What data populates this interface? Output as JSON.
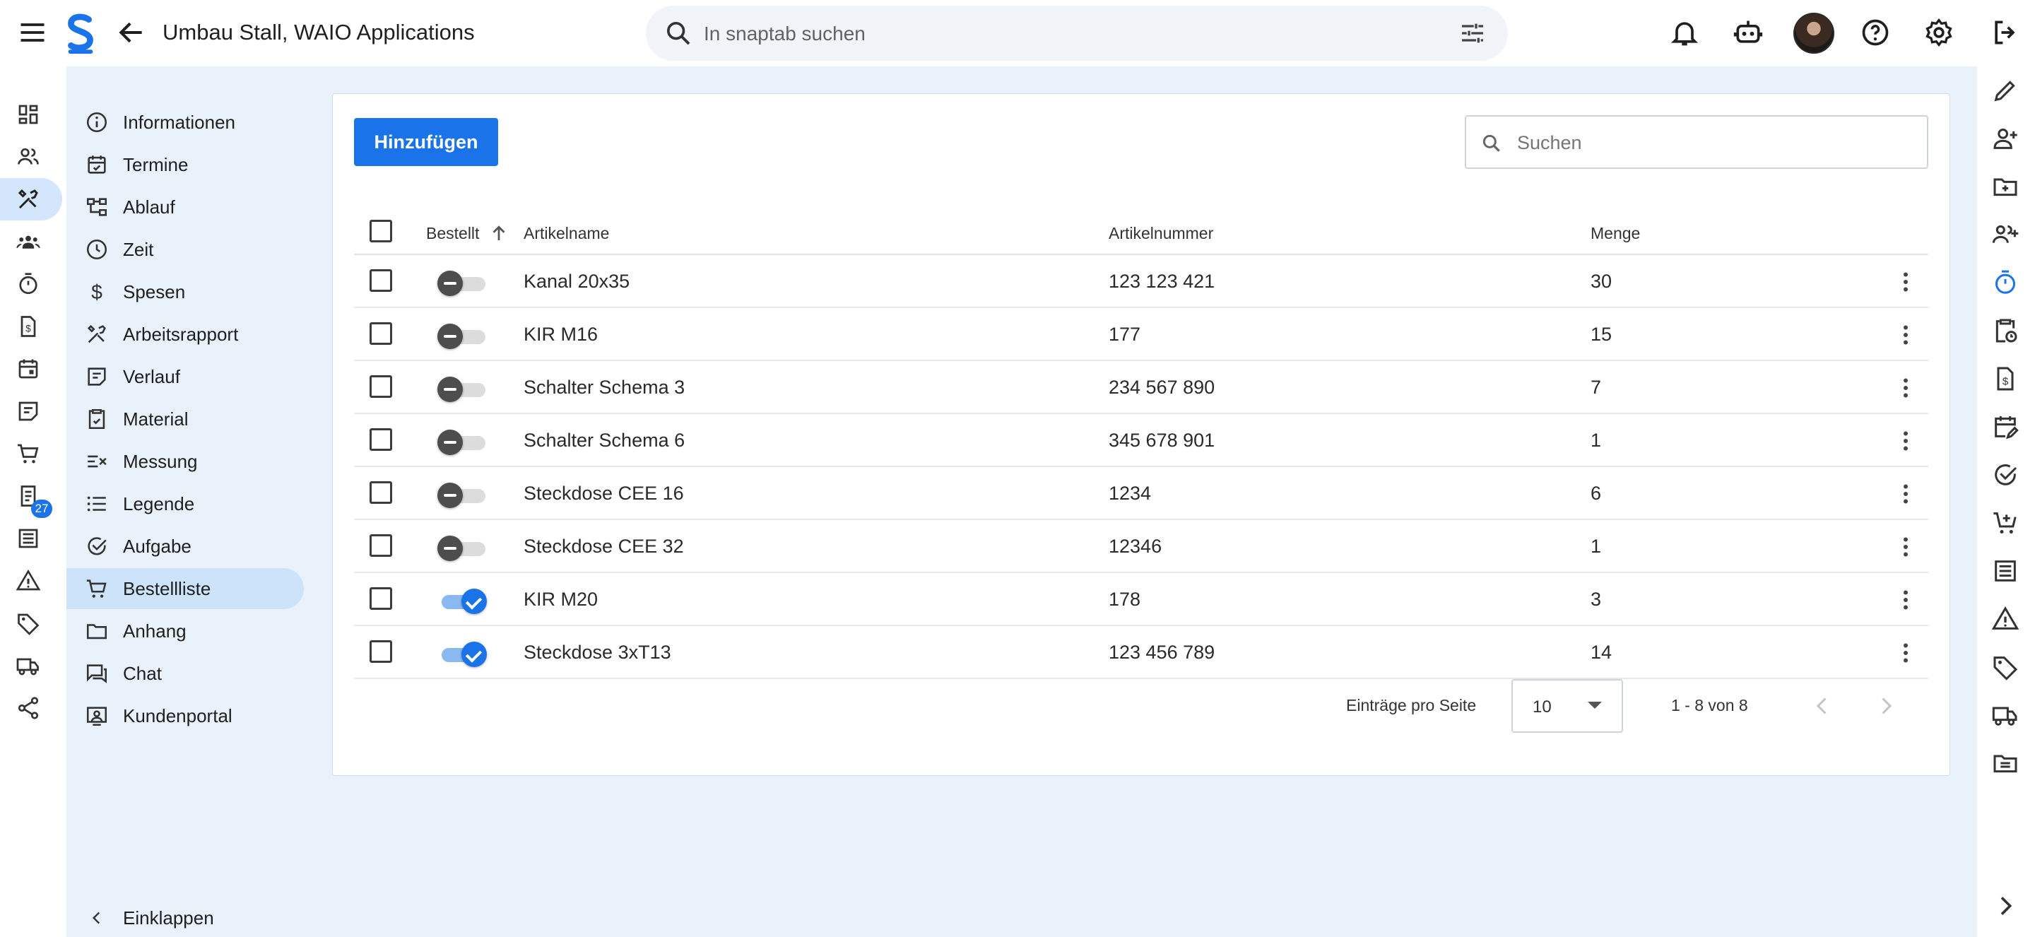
{
  "header": {
    "title": "Umbau Stall, WAIO Applications",
    "search_placeholder": "In snaptab suchen"
  },
  "colors": {
    "accent": "#1a73e8",
    "content_bg": "#e9f1fb",
    "active_nav": "#cde3fa"
  },
  "left_rail": {
    "icons": [
      "dashboard-icon",
      "contacts-icon",
      "tools-icon",
      "team-icon",
      "timer-icon",
      "invoice-icon",
      "calendar-icon",
      "notes-icon",
      "cart-icon",
      "receipt-icon",
      "list-icon",
      "warning-icon",
      "tag-icon",
      "truck-icon",
      "share-icon"
    ],
    "cart_badge": "27"
  },
  "subnav": {
    "items": [
      {
        "label": "Informationen",
        "icon": "info-icon"
      },
      {
        "label": "Termine",
        "icon": "calendar-check-icon"
      },
      {
        "label": "Ablauf",
        "icon": "flow-icon"
      },
      {
        "label": "Zeit",
        "icon": "clock-icon"
      },
      {
        "label": "Spesen",
        "icon": "dollar-icon"
      },
      {
        "label": "Arbeitsrapport",
        "icon": "tools-icon"
      },
      {
        "label": "Verlauf",
        "icon": "history-icon"
      },
      {
        "label": "Material",
        "icon": "clipboard-icon"
      },
      {
        "label": "Messung",
        "icon": "measure-icon"
      },
      {
        "label": "Legende",
        "icon": "list-icon"
      },
      {
        "label": "Aufgabe",
        "icon": "task-icon"
      },
      {
        "label": "Bestellliste",
        "icon": "cart-icon"
      },
      {
        "label": "Anhang",
        "icon": "folder-icon"
      },
      {
        "label": "Chat",
        "icon": "chat-icon"
      },
      {
        "label": "Kundenportal",
        "icon": "portal-icon"
      }
    ],
    "active_index": 11,
    "collapse_label": "Einklappen"
  },
  "toolbar": {
    "add_label": "Hinzufügen",
    "search_placeholder": "Suchen"
  },
  "table": {
    "columns": {
      "ordered": "Bestellt",
      "name": "Artikelname",
      "number": "Artikelnummer",
      "qty": "Menge"
    },
    "rows": [
      {
        "name": "Kanal 20x35",
        "number": "123 123 421",
        "qty": "30",
        "ordered": false
      },
      {
        "name": "KIR M16",
        "number": "177",
        "qty": "15",
        "ordered": false
      },
      {
        "name": "Schalter Schema 3",
        "number": "234 567 890",
        "qty": "7",
        "ordered": false
      },
      {
        "name": "Schalter Schema 6",
        "number": "345 678 901",
        "qty": "1",
        "ordered": false
      },
      {
        "name": "Steckdose CEE 16",
        "number": "1234",
        "qty": "6",
        "ordered": false
      },
      {
        "name": "Steckdose CEE 32",
        "number": "12346",
        "qty": "1",
        "ordered": false
      },
      {
        "name": "KIR M20",
        "number": "178",
        "qty": "3",
        "ordered": true
      },
      {
        "name": "Steckdose 3xT13",
        "number": "123 456 789",
        "qty": "14",
        "ordered": true
      }
    ]
  },
  "pagination": {
    "per_page_label": "Einträge pro Seite",
    "per_page_value": "10",
    "range": "1 - 8 von 8"
  },
  "right_rail": {
    "icons": [
      "edit-icon",
      "person-add-icon",
      "folder-add-icon",
      "group-add-icon",
      "stopwatch-icon",
      "clipboard-clock-icon",
      "invoice-icon",
      "calendar-edit-icon",
      "check-badge-icon",
      "cart-add-icon",
      "list-icon",
      "warning-icon",
      "tag-icon",
      "truck-icon",
      "folder-list-icon"
    ]
  }
}
